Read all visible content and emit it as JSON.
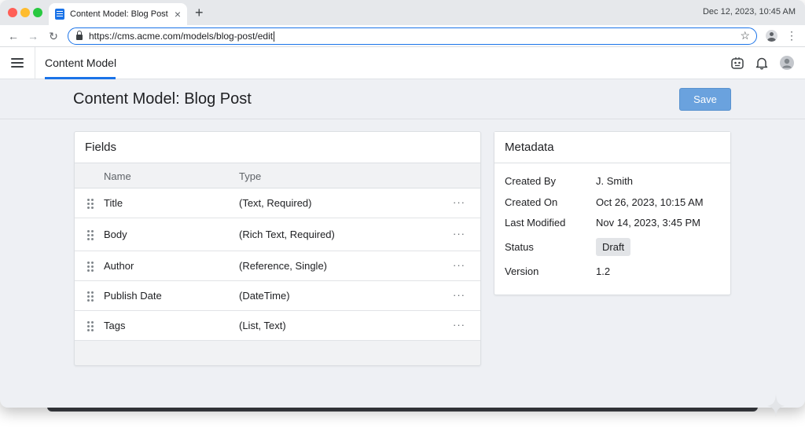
{
  "browser": {
    "tab_title": "Content Model: Blog Post",
    "tab_close": "×",
    "new_tab": "+",
    "clock": "Dec 12, 2023, 10:45 AM",
    "url": "https://cms.acme.com/models/blog-post/edit",
    "back": "←",
    "forward": "→",
    "reload": "↻",
    "star": "☆",
    "menu": "⋮"
  },
  "app": {
    "tab_label": "Content Model"
  },
  "page": {
    "title": "Content Model: Blog Post",
    "save_label": "Save"
  },
  "fields": {
    "heading": "Fields",
    "col_name": "Name",
    "col_type": "Type",
    "more": "···",
    "rows": [
      {
        "name": "Title",
        "type": "(Text, Required)"
      },
      {
        "name": "Body",
        "type": "(Rich Text, Required)"
      },
      {
        "name": "Author",
        "type": "(Reference, Single)"
      },
      {
        "name": "Publish Date",
        "type": "(DateTime)"
      },
      {
        "name": "Tags",
        "type": "(List, Text)"
      }
    ]
  },
  "metadata": {
    "heading": "Metadata",
    "created_by_label": "Created By",
    "created_by": "J. Smith",
    "created_on_label": "Created On",
    "created_on": "Oct 26, 2023, 10:15 AM",
    "last_modified_label": "Last Modified",
    "last_modified": "Nov 14, 2023, 3:45 PM",
    "status_label": "Status",
    "status": "Draft",
    "version_label": "Version",
    "version": "1.2"
  },
  "colors": {
    "accent": "#1a73e8",
    "save_button": "#6aa2de",
    "page_background": "#eef0f4"
  },
  "icons": {
    "header": [
      "extension-icon",
      "bell-icon",
      "user-avatar-icon"
    ]
  }
}
